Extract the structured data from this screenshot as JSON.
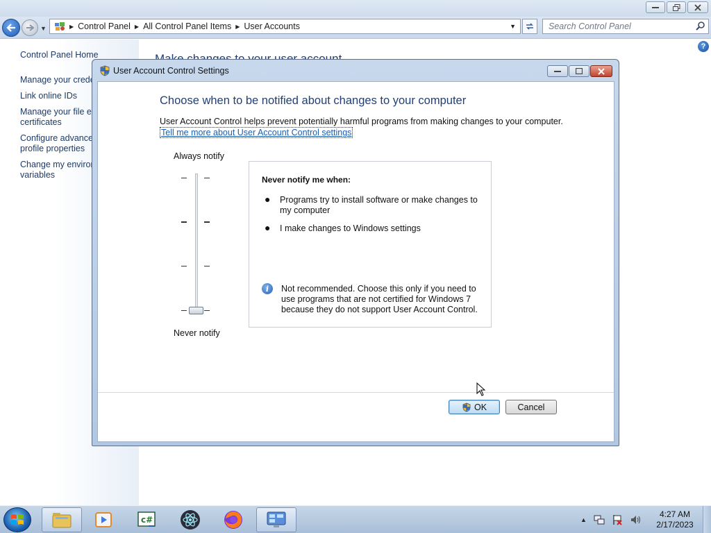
{
  "explorer": {
    "breadcrumbs": [
      "Control Panel",
      "All Control Panel Items",
      "User Accounts"
    ],
    "search_placeholder": "Search Control Panel",
    "left_pane": {
      "home": "Control Panel Home",
      "links": [
        "Manage your crede",
        "Link online IDs",
        "Manage your file er",
        "certificates",
        "Configure advance",
        "profile properties",
        "Change my environ",
        "variables"
      ]
    },
    "content_heading": "Make changes to your user account"
  },
  "uac": {
    "title": "User Account Control Settings",
    "heading": "Choose when to be notified about changes to your computer",
    "description": "User Account Control helps prevent potentially harmful programs from making changes to your computer.",
    "link": "Tell me more about User Account Control settings",
    "slider": {
      "top_label": "Always notify",
      "bottom_label": "Never notify",
      "levels": 4,
      "selected_level": 1
    },
    "info": {
      "title": "Never notify me when:",
      "bullets": [
        "Programs try to install software or make changes to my computer",
        "I make changes to Windows settings"
      ],
      "warning": "Not recommended. Choose this only if you need to use programs that are not certified for Windows 7 because they do not support User Account Control."
    },
    "ok_label": "OK",
    "cancel_label": "Cancel"
  },
  "taskbar": {
    "items": [
      "start-orb",
      "windows-explorer",
      "media-player",
      "csharp-editor",
      "electron-app",
      "firefox",
      "control-panel"
    ],
    "clock_time": "4:27 AM",
    "clock_date": "2/17/2023"
  },
  "colors": {
    "heading_blue": "#1e3f7a",
    "link_blue": "#1a5fb4",
    "taskbar": "#a8bfd8"
  }
}
